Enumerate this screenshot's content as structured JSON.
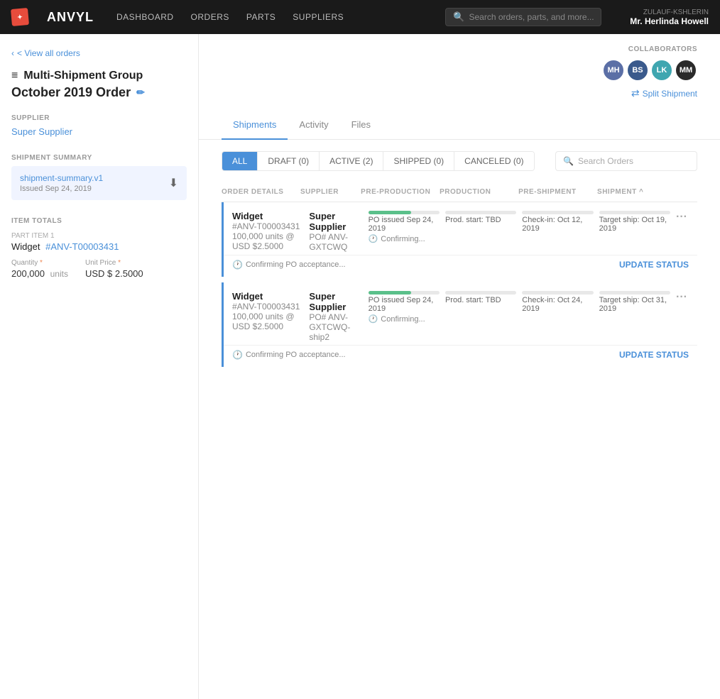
{
  "nav": {
    "logo": "ANVYL",
    "links": [
      "DASHBOARD",
      "ORDERS",
      "PARTS",
      "SUPPLIERS"
    ],
    "search_placeholder": "Search orders, parts, and more...",
    "user_company": "ZULAUF-KSHLERIN",
    "user_name": "Mr. Herlinda Howell"
  },
  "sidebar": {
    "back_label": "< View all orders",
    "group_icon": "≡",
    "group_title": "Multi-Shipment Group",
    "order_name": "October 2019 Order",
    "supplier_label": "SUPPLIER",
    "supplier_name": "Super Supplier",
    "shipment_summary_label": "SHIPMENT SUMMARY",
    "shipment_file_name": "shipment-summary.v1",
    "shipment_issued": "Issued Sep 24, 2019",
    "item_totals_label": "ITEM TOTALS",
    "part_label": "Part Item 1",
    "part_name": "Widget",
    "part_link": "#ANV-T00003431",
    "quantity_label": "Quantity",
    "quantity_value": "200,000",
    "quantity_unit": "units",
    "unit_price_label": "Unit Price",
    "unit_price_value": "USD $  2.5000"
  },
  "collaborators": {
    "label": "COLLABORATORS",
    "avatars": [
      {
        "initials": "MH",
        "color": "#5b6fa6"
      },
      {
        "initials": "BS",
        "color": "#3a5a8c"
      },
      {
        "initials": "LK",
        "color": "#3fa6b0"
      },
      {
        "initials": "MM",
        "color": "#2a2a2a"
      }
    ],
    "split_btn": "Split Shipment"
  },
  "tabs": {
    "items": [
      "Shipments",
      "Activity",
      "Files"
    ],
    "active": "Shipments"
  },
  "filter_bar": {
    "filters": [
      {
        "label": "ALL",
        "active": true
      },
      {
        "label": "DRAFT (0)",
        "active": false
      },
      {
        "label": "ACTIVE (2)",
        "active": false
      },
      {
        "label": "SHIPPED (0)",
        "active": false
      },
      {
        "label": "CANCELED (0)",
        "active": false
      }
    ],
    "search_placeholder": "Search Orders"
  },
  "table": {
    "headers": [
      "ORDER DETAILS",
      "SUPPLIER",
      "PRE-PRODUCTION",
      "PRODUCTION",
      "PRE-SHIPMENT",
      "SHIPMENT ^"
    ],
    "rows": [
      {
        "order_title": "Widget",
        "order_id": "#ANV-T00003431",
        "order_qty": "100,000 units @ USD $2.5000",
        "supplier_name": "Super Supplier",
        "po_num": "PO# ANV-GXTCWQ",
        "pre_production_text": "PO issued Sep 24, 2019",
        "pre_production_sub": "Confirming...",
        "pre_production_progress": 60,
        "production_text": "Prod. start: TBD",
        "production_progress": 0,
        "pre_shipment_text": "Check-in: Oct 12, 2019",
        "pre_shipment_progress": 0,
        "shipment_text": "Target ship: Oct 19, 2019",
        "shipment_progress": 0,
        "confirming_label": "Confirming PO acceptance...",
        "update_status": "UPDATE STATUS"
      },
      {
        "order_title": "Widget",
        "order_id": "#ANV-T00003431",
        "order_qty": "100,000 units @ USD $2.5000",
        "supplier_name": "Super Supplier",
        "po_num": "PO# ANV-GXTCWQ-ship2",
        "pre_production_text": "PO issued Sep 24, 2019",
        "pre_production_sub": "Confirming...",
        "pre_production_progress": 60,
        "production_text": "Prod. start: TBD",
        "production_progress": 0,
        "pre_shipment_text": "Check-in: Oct 24, 2019",
        "pre_shipment_progress": 0,
        "shipment_text": "Target ship: Oct 31, 2019",
        "shipment_progress": 0,
        "confirming_label": "Confirming PO acceptance...",
        "update_status": "UPDATE STATUS"
      }
    ]
  }
}
